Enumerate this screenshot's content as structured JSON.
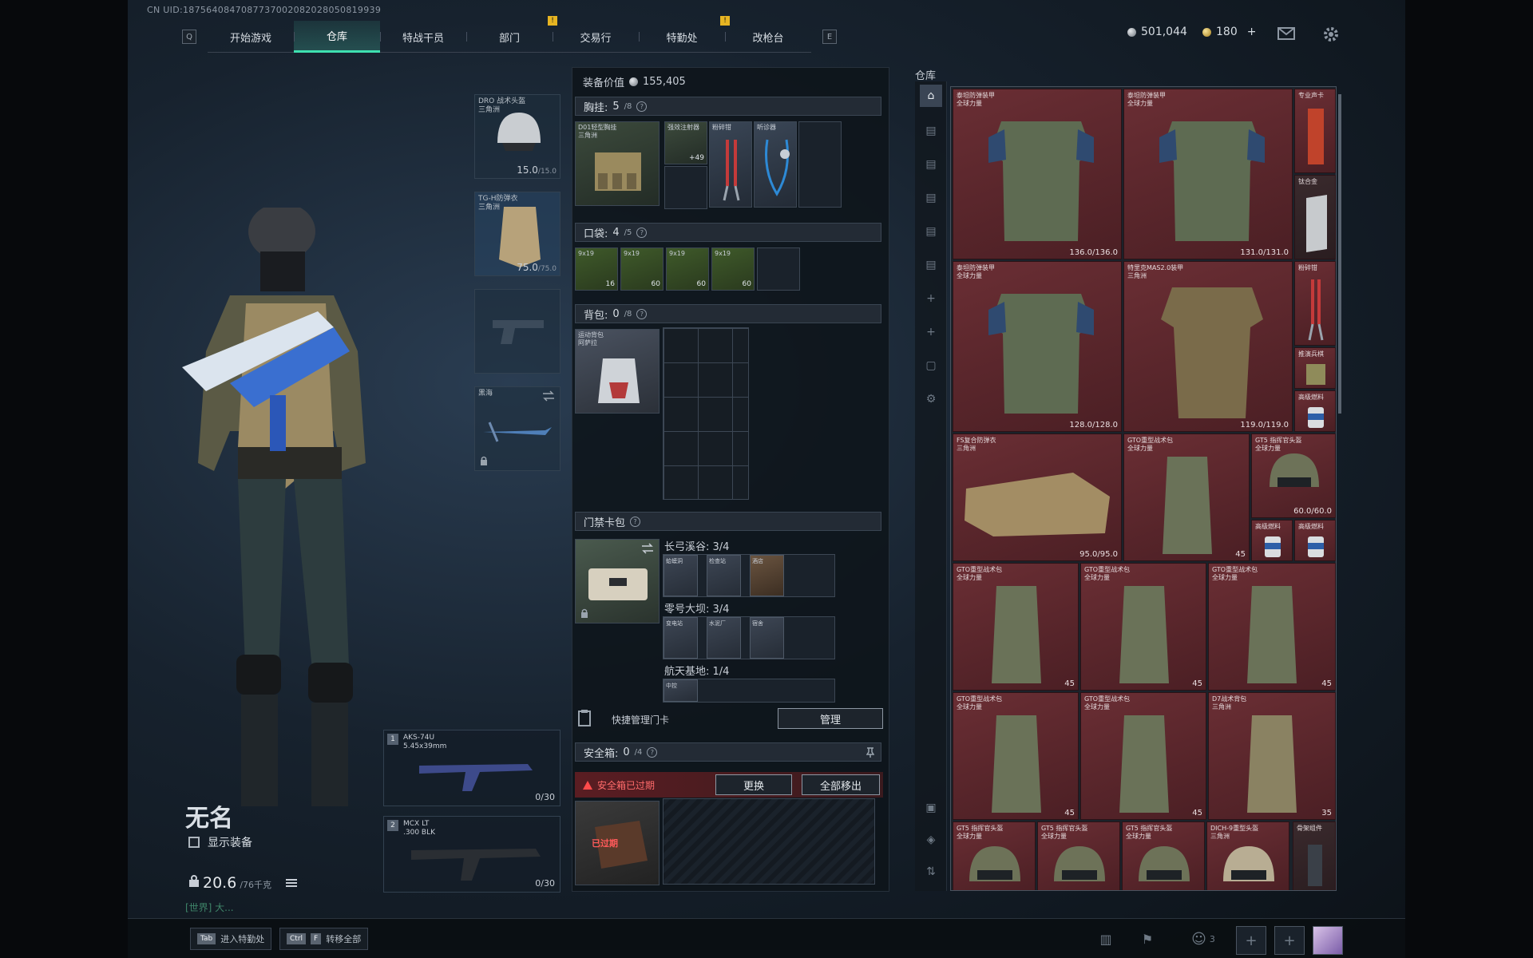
{
  "uid": "CN UID:1875640847087737002082028050819939",
  "nav": {
    "left_key": "Q",
    "right_key": "E",
    "tabs": [
      {
        "label": "开始游戏",
        "active": false,
        "pin": false
      },
      {
        "label": "仓库",
        "active": true,
        "pin": false
      },
      {
        "label": "特战干员",
        "active": false,
        "pin": false
      },
      {
        "label": "部门",
        "active": false,
        "pin": true
      },
      {
        "label": "交易行",
        "active": false,
        "pin": false
      },
      {
        "label": "特勤处",
        "active": false,
        "pin": true
      },
      {
        "label": "改枪台",
        "active": false,
        "pin": false
      }
    ],
    "pin_mark": "!"
  },
  "currency": {
    "silver": "501,044",
    "gold": "180",
    "gold_add": "+"
  },
  "operator": {
    "name": "无名",
    "show_equipment": "显示装备",
    "weight": "20.6",
    "weight_max": "/76千克",
    "chat": "[世界] 大..."
  },
  "equipment": {
    "helmet": {
      "name": "DRO 战术头盔",
      "sub": "三角洲",
      "dur": "15.0",
      "dur_max": "/15.0"
    },
    "armor": {
      "name": "TG-H防弹衣",
      "sub": "三角洲",
      "dur": "75.0",
      "dur_max": "/75.0"
    },
    "melee": {
      "name": "黑海"
    }
  },
  "weapons": [
    {
      "index": "1",
      "name": "AKS-74U",
      "caliber": "5.45x39mm",
      "ammo": "0/30"
    },
    {
      "index": "2",
      "name": "MCX LT",
      "caliber": ".300 BLK",
      "ammo": "0/30"
    }
  ],
  "loadout": {
    "value_label": "装备价值",
    "value": "155,405",
    "chest": {
      "label": "胸挂:",
      "count": "5",
      "max": "/8",
      "rig_name": "D01轻型胸挂",
      "rig_sub": "三角洲",
      "items": [
        {
          "label": "强效注射器",
          "count": "+49"
        },
        {
          "label": "粉碎钳"
        },
        {
          "label": "听诊器"
        }
      ]
    },
    "pocket": {
      "label": "口袋:",
      "count": "4",
      "max": "/5",
      "items": [
        {
          "label": "9x19",
          "count": "16"
        },
        {
          "label": "9x19",
          "count": "60"
        },
        {
          "label": "9x19",
          "count": "60"
        },
        {
          "label": "9x19",
          "count": "60"
        }
      ]
    },
    "backpack": {
      "label": "背包:",
      "count": "0",
      "max": "/8",
      "bag_name": "运动背包",
      "bag_sub": "阿萨拉"
    },
    "keycards": {
      "label": "门禁卡包",
      "maps": [
        {
          "name": "长弓溪谷: 3/4",
          "cards": [
            "蛤蟆洞",
            "检查站",
            "酒店"
          ]
        },
        {
          "name": "零号大坝: 3/4",
          "cards": [
            "变电站",
            "水泥厂",
            "宿舍"
          ]
        },
        {
          "name": "航天基地: 1/4",
          "cards": [
            "中控"
          ]
        }
      ]
    },
    "quick_manage": "快捷管理门卡",
    "manage": "管理",
    "safe": {
      "label": "安全箱:",
      "count": "0",
      "max": "/4",
      "expired": "安全箱已过期",
      "replace": "更换",
      "move_all": "全部移出",
      "expired_tag": "已过期"
    }
  },
  "warehouse": {
    "title": "仓库",
    "items": [
      {
        "name": "泰坦防弹装甲",
        "sub": "全球力量",
        "dur": "136.0/136.0"
      },
      {
        "name": "泰坦防弹装甲",
        "sub": "全球力量",
        "dur": "131.0/131.0"
      },
      {
        "name": "专业声卡",
        "sub": ""
      },
      {
        "name": "钛合金",
        "sub": ""
      },
      {
        "name": "泰坦防弹装甲",
        "sub": "全球力量",
        "dur": "128.0/128.0"
      },
      {
        "name": "特里克MAS2.0装甲",
        "sub": "三角洲",
        "dur": "119.0/119.0"
      },
      {
        "name": "粉碎钳",
        "sub": ""
      },
      {
        "name": "推演兵棋",
        "sub": ""
      },
      {
        "name": "高级燃料",
        "sub": ""
      },
      {
        "name": "FS复合防弹衣",
        "sub": "三角洲",
        "dur": "95.0/95.0"
      },
      {
        "name": "GTO重型战术包",
        "sub": "全球力量",
        "cap": "45"
      },
      {
        "name": "GT5 指挥官头盔",
        "sub": "全球力量",
        "dur": "60.0/60.0"
      },
      {
        "name": "高级燃料",
        "sub": ""
      },
      {
        "name": "高级燃料",
        "sub": ""
      },
      {
        "name": "GTO重型战术包",
        "sub": "全球力量",
        "cap": "45"
      },
      {
        "name": "GTO重型战术包",
        "sub": "全球力量",
        "cap": "45"
      },
      {
        "name": "GTO重型战术包",
        "sub": "全球力量",
        "cap": "45"
      },
      {
        "name": "GTO重型战术包",
        "sub": "全球力量",
        "cap": "45"
      },
      {
        "name": "GTO重型战术包",
        "sub": "全球力量",
        "cap": "45"
      },
      {
        "name": "D7战术背包",
        "sub": "三角洲",
        "cap": "35"
      },
      {
        "name": "GT5 指挥官头盔",
        "sub": "全球力量"
      },
      {
        "name": "GT5 指挥官头盔",
        "sub": "全球力量"
      },
      {
        "name": "GT5 指挥官头盔",
        "sub": "全球力量"
      },
      {
        "name": "DICH-9重型头盔",
        "sub": "三角洲"
      },
      {
        "name": "骨架组件",
        "sub": ""
      }
    ]
  },
  "bottom": {
    "tab_key": "Tab",
    "tab_label": "进入特勤处",
    "ctrl_key": "Ctrl",
    "f_key": "F",
    "ctrl_label": "转移全部",
    "squad_count": "3"
  }
}
